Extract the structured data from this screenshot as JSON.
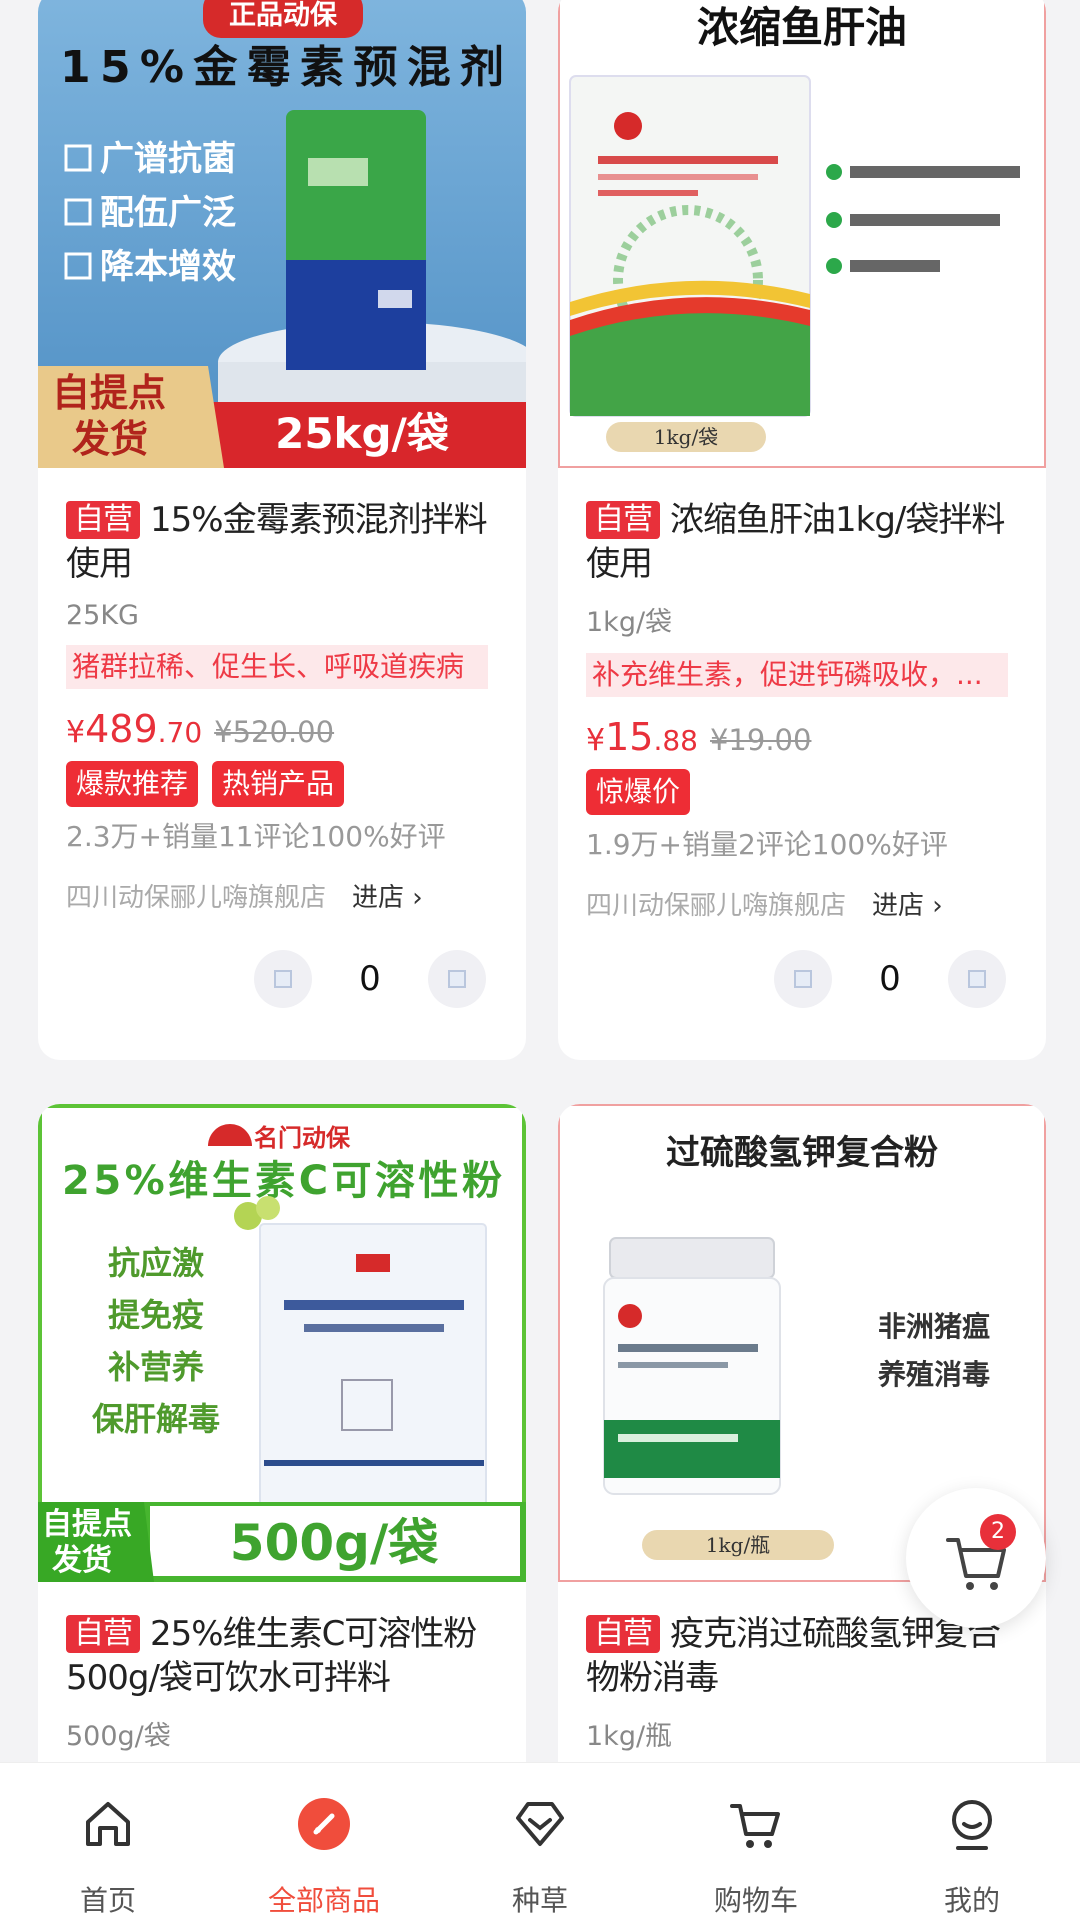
{
  "colors": {
    "accent": "#e8303a",
    "active_tab": "#f04d3c"
  },
  "products": [
    {
      "self_tag": "自营",
      "title": "15%金霉素预混剂拌料使用",
      "spec": "25KG",
      "desc": "猪群拉稀、促生长、呼吸道疾病",
      "price_symbol": "¥",
      "price_int": "489",
      "price_dec": ".70",
      "orig_price": "¥520.00",
      "badges": [
        "爆款推荐",
        "热销产品"
      ],
      "stats": "2.3万+销量11评论100%好评",
      "shop": "四川动保郦儿嗨旗舰店",
      "enter": "进店",
      "qty": "0",
      "image": {
        "ribbon": "正品动保",
        "headline": "15%金霉素预混剂",
        "bullets": [
          "广谱抗菌",
          "配伍广泛",
          "降本增效"
        ],
        "corner": [
          "自提点",
          "发货"
        ],
        "pack": "25kg/袋"
      }
    },
    {
      "self_tag": "自营",
      "title": "浓缩鱼肝油1kg/袋拌料使用",
      "spec": "1kg/袋",
      "desc": "补充维生素，促进钙磷吸收，...",
      "price_symbol": "¥",
      "price_int": "15",
      "price_dec": ".88",
      "orig_price": "¥19.00",
      "badges": [
        "惊爆价"
      ],
      "stats": "1.9万+销量2评论100%好评",
      "shop": "四川动保郦儿嗨旗舰店",
      "enter": "进店",
      "qty": "0",
      "image": {
        "headline": "浓缩鱼肝油",
        "pack": "1kg/袋"
      }
    },
    {
      "self_tag": "自营",
      "title": "25%维生素C可溶性粉500g/袋可饮水可拌料",
      "spec": "500g/袋",
      "image": {
        "brand": "名门动保",
        "headline": "25%维生素C可溶性粉",
        "bullets": [
          "抗应激",
          "提免疫",
          "补营养",
          "保肝解毒"
        ],
        "corner": [
          "自提点",
          "发货"
        ],
        "pack": "500g/袋"
      }
    },
    {
      "self_tag": "自营",
      "title": "疫克消过硫酸氢钾复合物粉消毒",
      "spec": "1kg/瓶",
      "image": {
        "headline": "过硫酸氢钾复合粉",
        "side": [
          "非洲猪瘟",
          "养殖消毒"
        ],
        "pack": "1kg/瓶"
      }
    }
  ],
  "float_cart": {
    "count": "2",
    "icon": "cart-icon"
  },
  "tabbar": [
    {
      "label": "首页",
      "icon": "home-icon"
    },
    {
      "label": "全部商品",
      "icon": "compass-icon",
      "active": true
    },
    {
      "label": "种草",
      "icon": "heart-diamond-icon"
    },
    {
      "label": "购物车",
      "icon": "cart-icon"
    },
    {
      "label": "我的",
      "icon": "user-icon"
    }
  ]
}
